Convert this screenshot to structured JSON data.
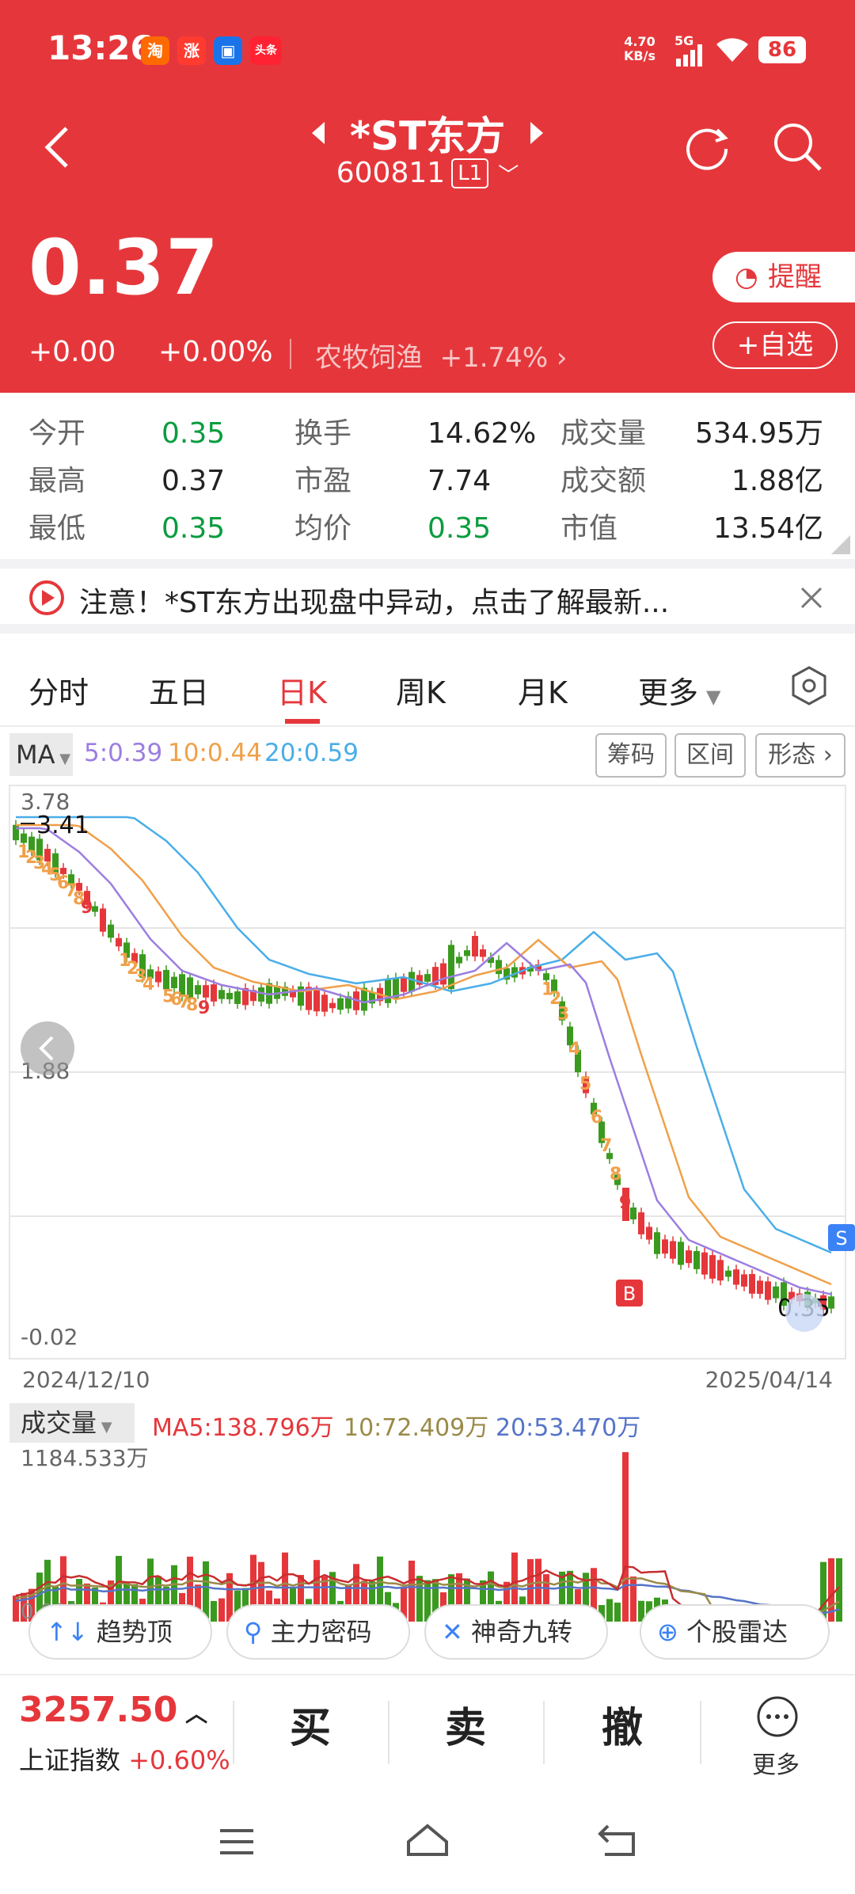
{
  "status_bar": {
    "time": "13:26",
    "apps": [
      "淘",
      "涨",
      "头条"
    ],
    "net_speed": "4.70",
    "net_unit": "KB/s",
    "signal": "5G",
    "battery": "86"
  },
  "header": {
    "name": "*ST东方",
    "code": "600811",
    "level": "L1",
    "price": "0.37",
    "change": "+0.00",
    "change_pct": "+0.00%",
    "sector": "农牧饲渔",
    "sector_pct": "+1.74%",
    "alert_label": "提醒",
    "watch_label": "+自选"
  },
  "stats": {
    "open_l": "今开",
    "open": "0.35",
    "high_l": "最高",
    "high": "0.37",
    "low_l": "最低",
    "low": "0.35",
    "turn_l": "换手",
    "turn": "14.62%",
    "pe_l": "市盈",
    "pe": "7.74",
    "avg_l": "均价",
    "avg": "0.35",
    "vol_l": "成交量",
    "vol": "534.95万",
    "amt_l": "成交额",
    "amt": "1.88亿",
    "cap_l": "市值",
    "cap": "13.54亿"
  },
  "notice": {
    "text": "注意！*ST东方出现盘中异动，点击了解最新..."
  },
  "tabs": [
    "分时",
    "五日",
    "日K",
    "周K",
    "月K",
    "更多"
  ],
  "ma": {
    "label": "MA",
    "ma5": "5:0.39",
    "ma10": "10:0.44",
    "ma20": "20:0.59",
    "tools": [
      "筹码",
      "区间",
      "形态"
    ]
  },
  "kline": {
    "y_top": "3.78",
    "y_mid": "1.88",
    "y_bot": "-0.02",
    "high_mark": "3.41",
    "last_mark": "0.35",
    "date_start": "2024/12/10",
    "date_end": "2025/04/14",
    "b_tag": "B",
    "s_tag": "S"
  },
  "volume": {
    "label": "成交量",
    "ma5": "MA5:138.796万",
    "ma10": "10:72.409万",
    "ma20": "20:53.470万",
    "max": "1184.533万",
    "min": "0.000"
  },
  "chips": [
    "趋势顶底",
    "主力密码",
    "神奇九转",
    "个股雷达"
  ],
  "index": {
    "value": "3257.50",
    "name": "上证指数",
    "pct": "+0.60%"
  },
  "actions": {
    "buy": "买",
    "sell": "卖",
    "cancel": "撤",
    "more": "更多"
  },
  "colors": {
    "red": "#e5373b",
    "green": "#0a9c3f"
  }
}
